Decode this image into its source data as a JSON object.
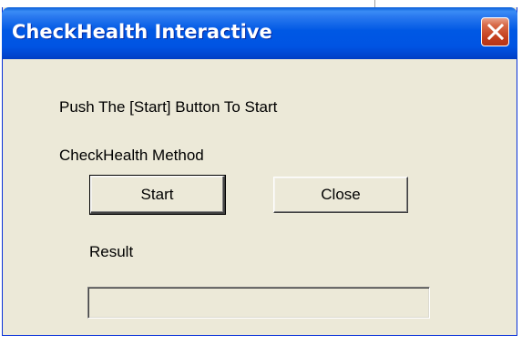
{
  "window": {
    "title": "CheckHealth Interactive"
  },
  "content": {
    "instruction": "Push The [Start] Button To  Start",
    "method_label": "CheckHealth Method",
    "start_label": "Start",
    "close_label": "Close",
    "result_label": "Result",
    "result_value": ""
  },
  "icons": {
    "close": "close-icon"
  },
  "colors": {
    "titlebar": "#0054e3",
    "window_face": "#ece9d8",
    "close_button": "#c4401e"
  }
}
